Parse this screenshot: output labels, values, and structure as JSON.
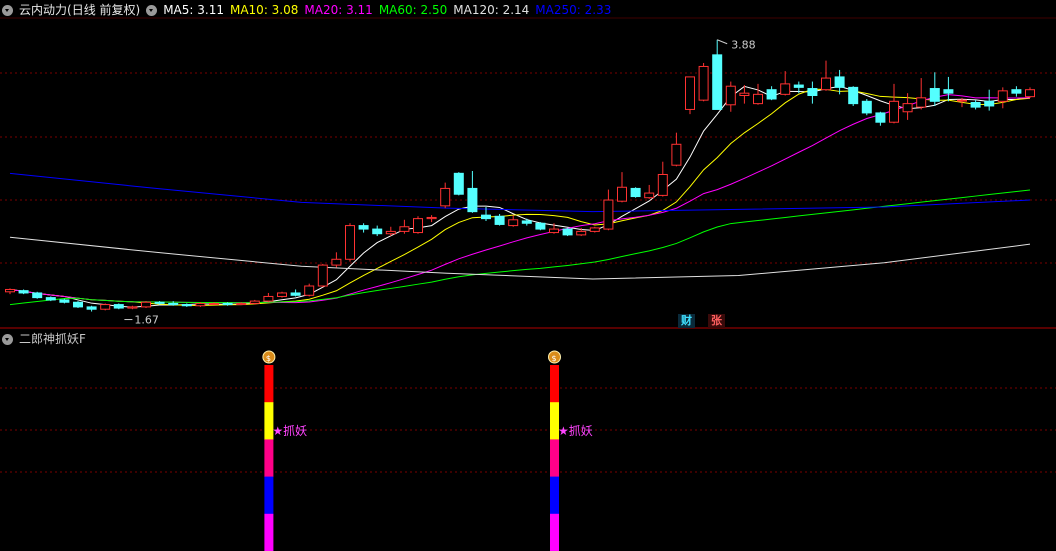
{
  "header": {
    "stock": "云内动力",
    "period": "(日线 前复权)",
    "ma": [
      {
        "label": "MA5: 3.11",
        "color": "#ffffff"
      },
      {
        "label": "MA10: 3.08",
        "color": "#ffff00"
      },
      {
        "label": "MA20: 3.11",
        "color": "#ff00ff"
      },
      {
        "label": "MA60: 2.50",
        "color": "#00ff00"
      },
      {
        "label": "MA120: 2.14",
        "color": "#e0e0e0"
      },
      {
        "label": "MA250: 2.33",
        "color": "#0000ff"
      }
    ]
  },
  "indicator": {
    "title": "二郎神抓妖F",
    "signal_label": "★抓妖"
  },
  "markers": {
    "cai": "财",
    "zhang": "张"
  },
  "chart_data": {
    "type": "candlestick",
    "price_range": [
      1.45,
      4.05
    ],
    "high_label": "3.88",
    "low_label": "1.67",
    "candles": [
      [
        1.71,
        1.73,
        1.74,
        1.69
      ],
      [
        1.72,
        1.7,
        1.73,
        1.69
      ],
      [
        1.7,
        1.66,
        1.71,
        1.65
      ],
      [
        1.66,
        1.64,
        1.67,
        1.63
      ],
      [
        1.64,
        1.62,
        1.65,
        1.61
      ],
      [
        1.62,
        1.58,
        1.63,
        1.57
      ],
      [
        1.58,
        1.56,
        1.59,
        1.54
      ],
      [
        1.56,
        1.6,
        1.61,
        1.55
      ],
      [
        1.6,
        1.57,
        1.61,
        1.56
      ],
      [
        1.57,
        1.58,
        1.59,
        1.56
      ],
      [
        1.58,
        1.62,
        1.63,
        1.57
      ],
      [
        1.62,
        1.61,
        1.63,
        1.6
      ],
      [
        1.61,
        1.6,
        1.63,
        1.59
      ],
      [
        1.6,
        1.59,
        1.61,
        1.58
      ],
      [
        1.59,
        1.61,
        1.62,
        1.58
      ],
      [
        1.61,
        1.61,
        1.62,
        1.6
      ],
      [
        1.61,
        1.6,
        1.62,
        1.59
      ],
      [
        1.6,
        1.61,
        1.62,
        1.6
      ],
      [
        1.61,
        1.63,
        1.64,
        1.6
      ],
      [
        1.63,
        1.67,
        1.7,
        1.62
      ],
      [
        1.67,
        1.7,
        1.71,
        1.66
      ],
      [
        1.7,
        1.68,
        1.73,
        1.67
      ],
      [
        1.68,
        1.76,
        1.78,
        1.67
      ],
      [
        1.76,
        1.94,
        1.95,
        1.75
      ],
      [
        1.94,
        1.99,
        2.05,
        1.92
      ],
      [
        1.99,
        2.28,
        2.3,
        1.97
      ],
      [
        2.28,
        2.25,
        2.3,
        2.22
      ],
      [
        2.25,
        2.21,
        2.28,
        2.19
      ],
      [
        2.21,
        2.23,
        2.27,
        2.19
      ],
      [
        2.23,
        2.27,
        2.33,
        2.21
      ],
      [
        2.22,
        2.34,
        2.36,
        2.21
      ],
      [
        2.34,
        2.35,
        2.37,
        2.31
      ],
      [
        2.45,
        2.6,
        2.65,
        2.43
      ],
      [
        2.73,
        2.55,
        2.74,
        2.54
      ],
      [
        2.6,
        2.4,
        2.75,
        2.39
      ],
      [
        2.37,
        2.34,
        2.44,
        2.32
      ],
      [
        2.36,
        2.29,
        2.38,
        2.28
      ],
      [
        2.28,
        2.33,
        2.37,
        2.27
      ],
      [
        2.32,
        2.3,
        2.34,
        2.28
      ],
      [
        2.3,
        2.25,
        2.31,
        2.24
      ],
      [
        2.22,
        2.25,
        2.3,
        2.21
      ],
      [
        2.25,
        2.2,
        2.26,
        2.19
      ],
      [
        2.2,
        2.23,
        2.26,
        2.19
      ],
      [
        2.23,
        2.26,
        2.27,
        2.22
      ],
      [
        2.25,
        2.5,
        2.59,
        2.24
      ],
      [
        2.49,
        2.61,
        2.74,
        2.48
      ],
      [
        2.6,
        2.53,
        2.61,
        2.52
      ],
      [
        2.52,
        2.56,
        2.63,
        2.51
      ],
      [
        2.54,
        2.72,
        2.83,
        2.53
      ],
      [
        2.8,
        2.98,
        3.08,
        2.79
      ],
      [
        3.28,
        3.56,
        3.56,
        3.24
      ],
      [
        3.36,
        3.65,
        3.68,
        3.35
      ],
      [
        3.75,
        3.28,
        3.88,
        3.28
      ],
      [
        3.32,
        3.48,
        3.52,
        3.26
      ],
      [
        3.4,
        3.42,
        3.49,
        3.33
      ],
      [
        3.33,
        3.41,
        3.5,
        3.32
      ],
      [
        3.45,
        3.37,
        3.48,
        3.36
      ],
      [
        3.41,
        3.5,
        3.61,
        3.4
      ],
      [
        3.49,
        3.47,
        3.52,
        3.42
      ],
      [
        3.46,
        3.4,
        3.52,
        3.33
      ],
      [
        3.45,
        3.55,
        3.7,
        3.44
      ],
      [
        3.56,
        3.47,
        3.62,
        3.41
      ],
      [
        3.47,
        3.33,
        3.48,
        3.31
      ],
      [
        3.35,
        3.25,
        3.37,
        3.23
      ],
      [
        3.25,
        3.17,
        3.26,
        3.14
      ],
      [
        3.17,
        3.35,
        3.5,
        3.16
      ],
      [
        3.26,
        3.33,
        3.42,
        3.19
      ],
      [
        3.3,
        3.38,
        3.55,
        3.28
      ],
      [
        3.46,
        3.35,
        3.6,
        3.31
      ],
      [
        3.45,
        3.42,
        3.56,
        3.35
      ],
      [
        3.36,
        3.36,
        3.38,
        3.3
      ],
      [
        3.34,
        3.3,
        3.36,
        3.28
      ],
      [
        3.35,
        3.31,
        3.45,
        3.27
      ],
      [
        3.35,
        3.44,
        3.47,
        3.29
      ],
      [
        3.45,
        3.42,
        3.48,
        3.39
      ],
      [
        3.39,
        3.45,
        3.47,
        3.38
      ]
    ],
    "ma_lines": [
      {
        "name": "MA5",
        "color": "#ffffff"
      },
      {
        "name": "MA10",
        "color": "#ffff00"
      },
      {
        "name": "MA20",
        "color": "#ff00ff"
      },
      {
        "name": "MA60",
        "color": "#00ff00"
      },
      {
        "name": "MA120",
        "color": "#e0e0e0",
        "values": [
          2.18,
          2.05,
          1.93,
          1.87,
          1.82,
          1.85,
          1.96,
          2.12
        ]
      },
      {
        "name": "MA250",
        "color": "#0000ff",
        "values": [
          2.73,
          2.6,
          2.48,
          2.43,
          2.4,
          2.42,
          2.44,
          2.5
        ]
      }
    ],
    "signals": [
      {
        "index": 19,
        "segment_colors": [
          "#ff0000",
          "#ffff00",
          "#ff0088",
          "#0000ff",
          "#ff00ff"
        ]
      },
      {
        "index": 40,
        "segment_colors": [
          "#ff0000",
          "#ffff00",
          "#ff0088",
          "#0000ff",
          "#ff00ff"
        ]
      }
    ]
  }
}
